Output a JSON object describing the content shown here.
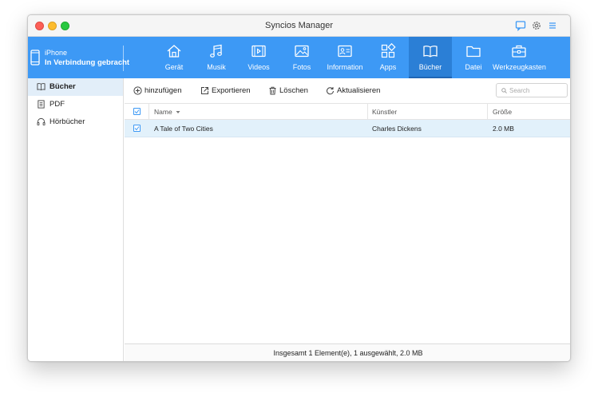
{
  "window": {
    "title": "Syncios Manager"
  },
  "device": {
    "name": "iPhone",
    "status": "In Verbindung gebracht"
  },
  "nav": {
    "items": [
      {
        "label": "Gerät",
        "icon": "home-icon"
      },
      {
        "label": "Musik",
        "icon": "music-icon"
      },
      {
        "label": "Videos",
        "icon": "video-icon"
      },
      {
        "label": "Fotos",
        "icon": "photo-icon"
      },
      {
        "label": "Information",
        "icon": "contact-card-icon"
      },
      {
        "label": "Apps",
        "icon": "apps-icon"
      },
      {
        "label": "Bücher",
        "icon": "book-icon",
        "active": true
      },
      {
        "label": "Datei",
        "icon": "folder-icon"
      },
      {
        "label": "Werkzeugkasten",
        "icon": "toolbox-icon"
      }
    ]
  },
  "sidebar": {
    "items": [
      {
        "label": "Bücher",
        "icon": "book-icon",
        "active": true
      },
      {
        "label": "PDF",
        "icon": "pdf-icon"
      },
      {
        "label": "Hörbücher",
        "icon": "headphones-icon"
      }
    ]
  },
  "toolbar": {
    "add_label": "hinzufügen",
    "export_label": "Exportieren",
    "delete_label": "Löschen",
    "refresh_label": "Aktualisieren",
    "search_placeholder": "Search"
  },
  "table": {
    "columns": [
      "Name",
      "Künstler",
      "Größe"
    ],
    "rows": [
      {
        "name": "A Tale of Two Cities",
        "artist": "Charles Dickens",
        "size": "2.0 MB",
        "checked": true
      }
    ]
  },
  "status": {
    "text": "Insgesamt 1 Element(e), 1 ausgewählt, 2.0 MB"
  },
  "colors": {
    "accent": "#3d99f5",
    "active_nav": "#2b7fd6",
    "selected_row": "#e2f1fb"
  }
}
